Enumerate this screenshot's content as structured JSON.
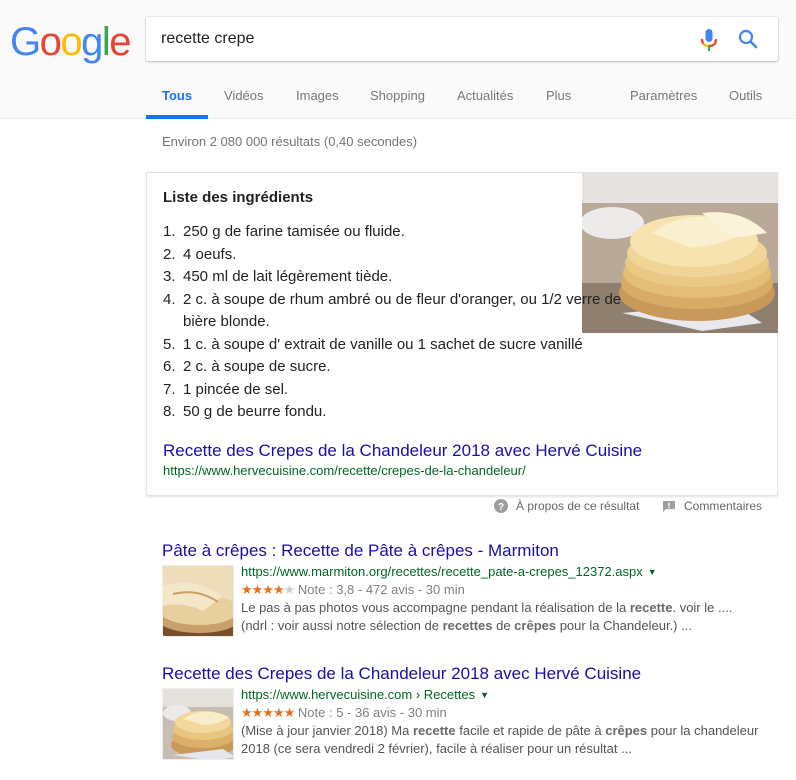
{
  "header": {
    "logo_letters": [
      {
        "ch": "G",
        "color": "#4285f4"
      },
      {
        "ch": "o",
        "color": "#ea4335"
      },
      {
        "ch": "o",
        "color": "#fbbc05"
      },
      {
        "ch": "g",
        "color": "#4285f4"
      },
      {
        "ch": "l",
        "color": "#34a853"
      },
      {
        "ch": "e",
        "color": "#ea4335"
      }
    ],
    "search_query": "recette crepe",
    "mic_icon": "microphone-icon",
    "search_icon": "magnifier-icon"
  },
  "tabs": [
    {
      "label": "Tous",
      "active": true
    },
    {
      "label": "Vidéos",
      "active": false
    },
    {
      "label": "Images",
      "active": false
    },
    {
      "label": "Shopping",
      "active": false
    },
    {
      "label": "Actualités",
      "active": false
    },
    {
      "label": "Plus",
      "active": false
    }
  ],
  "tools": {
    "settings": "Paramètres",
    "tools": "Outils"
  },
  "stats": "Environ 2 080 000 résultats (0,40 secondes)",
  "featured": {
    "title": "Liste des ingrédients",
    "ingredients": [
      {
        "num": "1.",
        "text": "250 g de farine tamisée ou fluide."
      },
      {
        "num": "2.",
        "text": "4 oeufs."
      },
      {
        "num": "3.",
        "text": "450 ml de lait légèrement tiède."
      },
      {
        "num": "4.",
        "text": "2 c. à soupe de rhum ambré ou de fleur d'oranger, ou 1/2 verre de bière blonde."
      },
      {
        "num": "5.",
        "text": "1 c. à soupe d' extrait de vanille ou 1 sachet de sucre vanillé"
      },
      {
        "num": "6.",
        "text": "2 c. à soupe de sucre."
      },
      {
        "num": "7.",
        "text": "1 pincée de sel."
      },
      {
        "num": "8.",
        "text": "50 g de beurre fondu."
      }
    ],
    "link_title": "Recette des Crepes de la Chandeleur 2018 avec Hervé Cuisine",
    "link_url": "https://www.hervecuisine.com/recette/crepes-de-la-chandeleur/",
    "about_label": "À propos de ce résultat",
    "feedback_label": "Commentaires"
  },
  "results": [
    {
      "title": "Pâte à crêpes : Recette de Pâte à crêpes - Marmiton",
      "url": "https://www.marmiton.org/recettes/recette_pate-a-crepes_12372.aspx",
      "rating": 3.8,
      "stars_filled": 4,
      "stars_total": 5,
      "rating_text": "Note : 3,8 - 472 avis - 30 min",
      "snippet_lines": [
        [
          {
            "t": "Le pas à pas photos vous accompagne pendant la réalisation de la "
          },
          {
            "b": "recette"
          },
          {
            "t": ". voir le ...."
          }
        ],
        [
          {
            "t": "(ndrl : voir aussi notre sélection de "
          },
          {
            "b": "recettes"
          },
          {
            "t": " de "
          },
          {
            "b": "crêpes"
          },
          {
            "t": " pour la Chandeleur.) ..."
          }
        ]
      ]
    },
    {
      "title": "Recette des Crepes de la Chandeleur 2018 avec Hervé Cuisine",
      "url": "https://www.hervecuisine.com › Recettes",
      "rating": 5,
      "stars_filled": 5,
      "stars_total": 5,
      "rating_text": "Note : 5 - 36 avis - 30 min",
      "snippet_lines": [
        [
          {
            "t": "(Mise à jour janvier 2018) Ma "
          },
          {
            "b": "recette"
          },
          {
            "t": " facile et rapide de pâte à "
          },
          {
            "b": "crêpes"
          },
          {
            "t": " pour la chandeleur"
          }
        ],
        [
          {
            "t": "2018 (ce sera vendredi 2 février), facile à réaliser pour un résultat ..."
          }
        ]
      ]
    }
  ],
  "colors": {
    "link": "#1a0dab",
    "url": "#006621",
    "accent": "#1a73e8",
    "star": "#e7711b"
  }
}
